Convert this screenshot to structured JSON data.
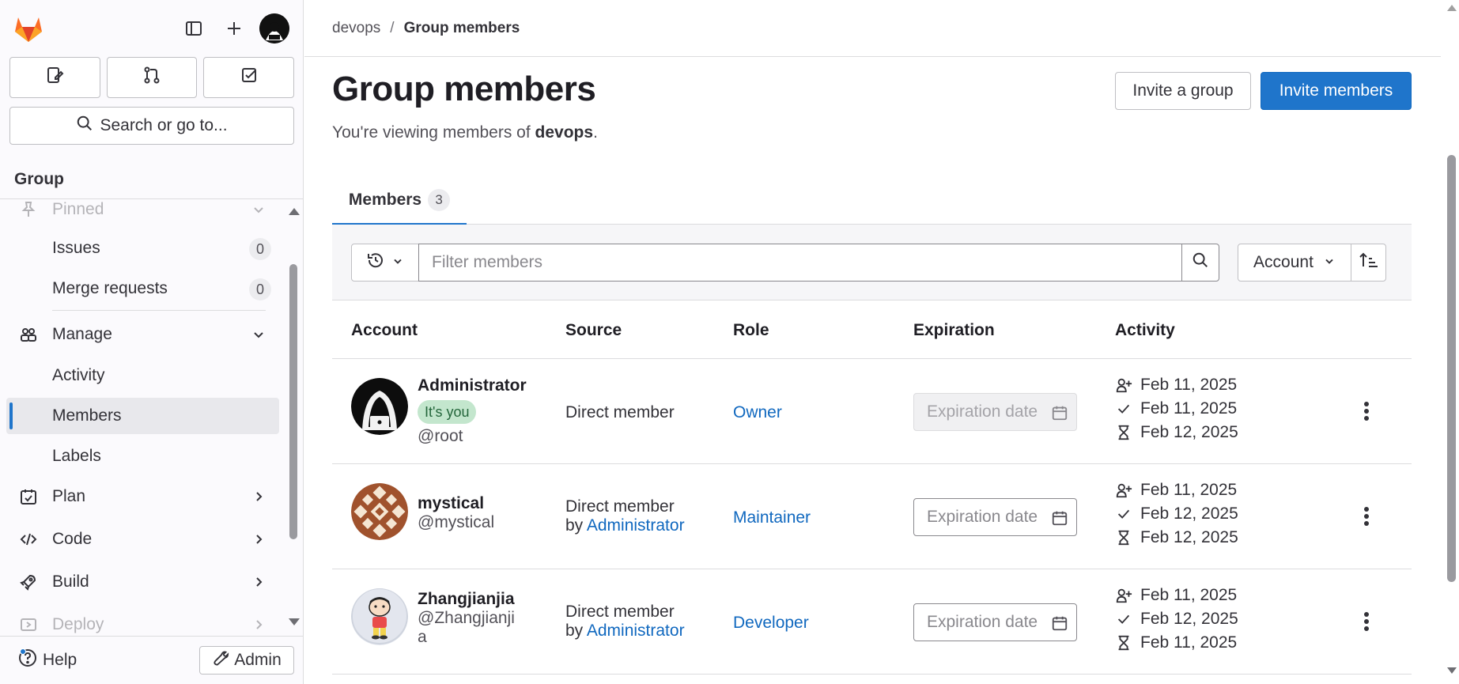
{
  "sidebar": {
    "search_label": "Search or go to...",
    "context_title": "Group",
    "items": {
      "pinned": "Pinned",
      "issues": {
        "label": "Issues",
        "count": "0"
      },
      "merge_requests": {
        "label": "Merge requests",
        "count": "0"
      },
      "manage": "Manage",
      "activity": "Activity",
      "members": "Members",
      "labels": "Labels",
      "plan": "Plan",
      "code": "Code",
      "build": "Build",
      "deploy": "Deploy"
    },
    "help_label": "Help",
    "admin_label": "Admin"
  },
  "breadcrumb": {
    "parent": "devops",
    "separator": "/",
    "current": "Group members"
  },
  "page": {
    "title": "Group members",
    "subtitle_prefix": "You're viewing members of ",
    "subtitle_group": "devops",
    "subtitle_suffix": ".",
    "invite_group_label": "Invite a group",
    "invite_members_label": "Invite members"
  },
  "tabs": [
    {
      "label": "Members",
      "count": "3"
    }
  ],
  "filter": {
    "placeholder": "Filter members",
    "sort_label": "Account"
  },
  "table": {
    "headers": [
      "Account",
      "Source",
      "Role",
      "Expiration",
      "Activity"
    ],
    "rows": [
      {
        "name": "Administrator",
        "badge": "It's you",
        "username": "@root",
        "source_line1": "Direct member",
        "source_by": "",
        "source_link": "",
        "role": "Owner",
        "expiration_placeholder": "Expiration date",
        "activity": [
          "Feb 11, 2025",
          "Feb 11, 2025",
          "Feb 12, 2025"
        ]
      },
      {
        "name": "mystical",
        "username": "@mystical",
        "source_line1": "Direct member",
        "source_by": "by ",
        "source_link": "Administrator",
        "role": "Maintainer",
        "expiration_placeholder": "Expiration date",
        "activity": [
          "Feb 11, 2025",
          "Feb 12, 2025",
          "Feb 12, 2025"
        ]
      },
      {
        "name": "Zhangjianjia",
        "username_line1": "@Zhangjianji",
        "username_line2": "a",
        "source_line1": "Direct member",
        "source_by": "by ",
        "source_link": "Administrator",
        "role": "Developer",
        "expiration_placeholder": "Expiration date",
        "activity": [
          "Feb 11, 2025",
          "Feb 12, 2025",
          "Feb 11, 2025"
        ]
      }
    ]
  },
  "colors": {
    "accent": "#1f75cb",
    "link": "#1068bf",
    "badge_bg": "#c3e6cd",
    "badge_text": "#24663b"
  },
  "icons": {
    "activity": [
      "user-joined-icon",
      "check-icon",
      "hourglass-icon"
    ]
  }
}
